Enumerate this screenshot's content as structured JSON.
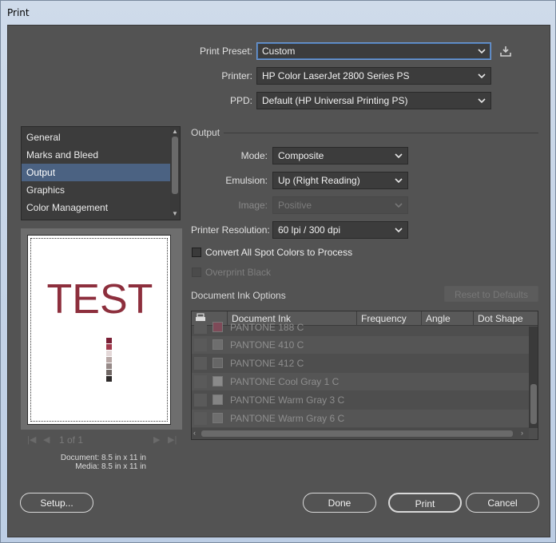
{
  "window": {
    "title": "Print"
  },
  "preset": {
    "label": "Print Preset:",
    "value": "Custom"
  },
  "printer": {
    "label": "Printer:",
    "value": "HP Color LaserJet 2800 Series PS"
  },
  "ppd": {
    "label": "PPD:",
    "value": "Default (HP Universal Printing PS)"
  },
  "sidebar": {
    "items": [
      {
        "label": "General"
      },
      {
        "label": "Marks and Bleed"
      },
      {
        "label": "Output"
      },
      {
        "label": "Graphics"
      },
      {
        "label": "Color Management"
      }
    ],
    "selected": "Output"
  },
  "preview": {
    "sample_text": "TEST",
    "swatch_colors": [
      "#7a1f35",
      "#a03a4c",
      "#e4d8d8",
      "#b8a8a6",
      "#968a88",
      "#716865",
      "#2e2a2a"
    ],
    "page_indicator": "1 of 1",
    "document_size": "Document: 8.5 in x 11 in",
    "media_size": "Media: 8.5 in x 11 in"
  },
  "output": {
    "section_title": "Output",
    "mode": {
      "label": "Mode:",
      "value": "Composite"
    },
    "emulsion": {
      "label": "Emulsion:",
      "value": "Up (Right Reading)"
    },
    "image": {
      "label": "Image:",
      "value": "Positive"
    },
    "resolution": {
      "label": "Printer Resolution:",
      "value": "60 lpi / 300 dpi"
    },
    "convert_spot": {
      "label": "Convert All Spot Colors to Process",
      "checked": false
    },
    "overprint_black": {
      "label": "Overprint Black",
      "checked": false,
      "disabled": true
    }
  },
  "ink_options": {
    "title": "Document Ink Options",
    "reset_button": "Reset to Defaults",
    "columns": [
      "Document Ink",
      "Frequency",
      "Angle",
      "Dot Shape"
    ],
    "rows": [
      {
        "ink": "PANTONE 188 C",
        "swatch": "#7e4a58"
      },
      {
        "ink": "PANTONE 410 C",
        "swatch": "#6e6e6e"
      },
      {
        "ink": "PANTONE 412 C",
        "swatch": "#666666"
      },
      {
        "ink": "PANTONE Cool Gray 1 C",
        "swatch": "#8a8a8a"
      },
      {
        "ink": "PANTONE Warm Gray 3 C",
        "swatch": "#848484"
      },
      {
        "ink": "PANTONE Warm Gray 6 C",
        "swatch": "#6e6e6e"
      }
    ]
  },
  "buttons": {
    "setup": "Setup...",
    "done": "Done",
    "print": "Print",
    "cancel": "Cancel"
  }
}
